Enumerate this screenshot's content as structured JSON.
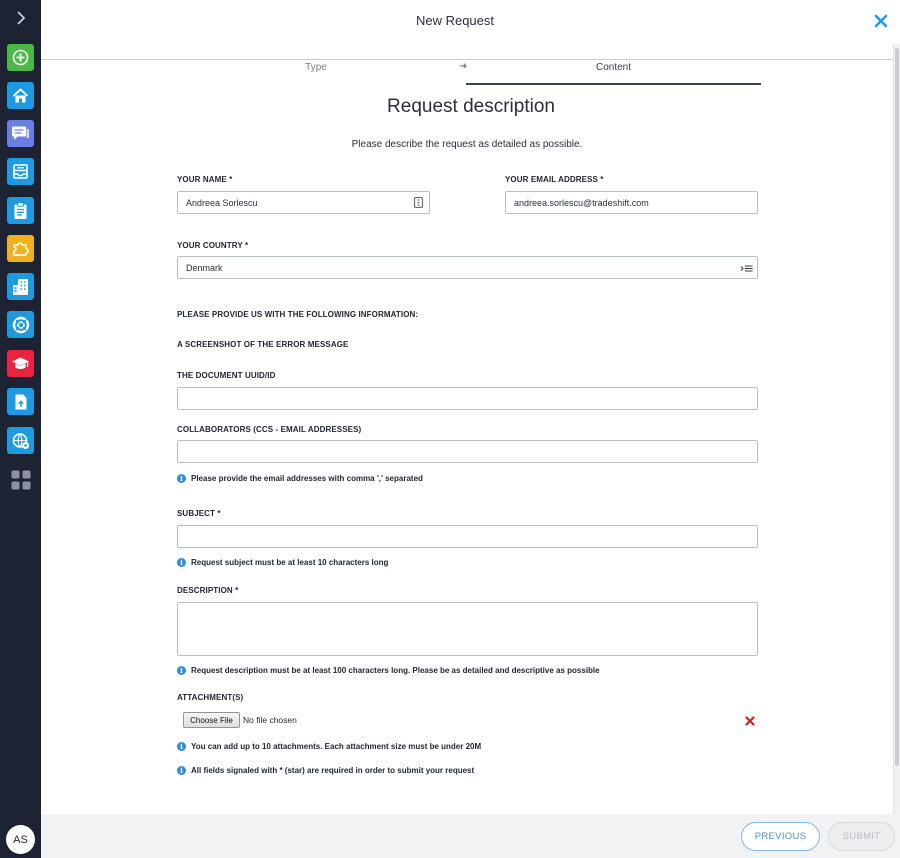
{
  "sidebar": {
    "user_initials": "AS",
    "icons": [
      {
        "name": "add-icon",
        "color": "#4cb848"
      },
      {
        "name": "home-icon",
        "color": "#1e9be0"
      },
      {
        "name": "chat-icon",
        "color": "#6a7fe6"
      },
      {
        "name": "inbox-icon",
        "color": "#1e9be0"
      },
      {
        "name": "clipboard-icon",
        "color": "#1e9be0"
      },
      {
        "name": "puzzle-icon",
        "color": "#f2b01e"
      },
      {
        "name": "building-icon",
        "color": "#1e9be0"
      },
      {
        "name": "lifebuoy-icon",
        "color": "#1e9be0"
      },
      {
        "name": "graduation-cap-icon",
        "color": "#e8243f"
      },
      {
        "name": "upload-icon",
        "color": "#1e9be0"
      },
      {
        "name": "globe-settings-icon",
        "color": "#1e9be0"
      },
      {
        "name": "apps-grid-icon",
        "color": "#8b93a3"
      }
    ]
  },
  "header": {
    "title": "New Request"
  },
  "steps": {
    "type_label": "Type",
    "content_label": "Content",
    "active": "Content"
  },
  "page": {
    "title": "Request description",
    "subtitle": "Please describe the request as detailed as possible."
  },
  "form": {
    "name_label": "YOUR NAME *",
    "name_value": "Andreea Sorlescu",
    "email_label": "YOUR EMAIL ADDRESS *",
    "email_value": "andreea.sorlescu@tradeshift.com",
    "country_label": "YOUR COUNTRY *",
    "country_value": "Denmark",
    "info_heading": "PLEASE PROVIDE US WITH THE FOLLOWING INFORMATION:",
    "screenshot_heading": "A SCREENSHOT OF THE ERROR MESSAGE",
    "uuid_label": "THE DOCUMENT UUID/ID",
    "uuid_value": "",
    "collab_label": "COLLABORATORS (CCS - EMAIL ADDRESSES)",
    "collab_value": "",
    "collab_hint": "Please provide the email addresses with comma ',' separated",
    "subject_label": "SUBJECT *",
    "subject_value": "",
    "subject_hint": "Request subject must be at least 10 characters long",
    "description_label": "DESCRIPTION *",
    "description_value": "",
    "description_hint": "Request description must be at least 100 characters long. Please be as detailed and descriptive as possible",
    "attachments_label": "ATTACHMENT(S)",
    "choose_file_label": "Choose File",
    "file_status": "No file chosen",
    "attachments_hint": "You can add up to 10 attachments. Each attachment size must be under 20M",
    "required_hint": "All fields signaled with * (star) are required in order to submit your request"
  },
  "footer": {
    "previous_label": "PREVIOUS",
    "submit_label": "SUBMIT"
  },
  "colors": {
    "sidebar_bg": "#1d2333",
    "accent_blue": "#1e9be0",
    "remove_red": "#d0221f"
  }
}
